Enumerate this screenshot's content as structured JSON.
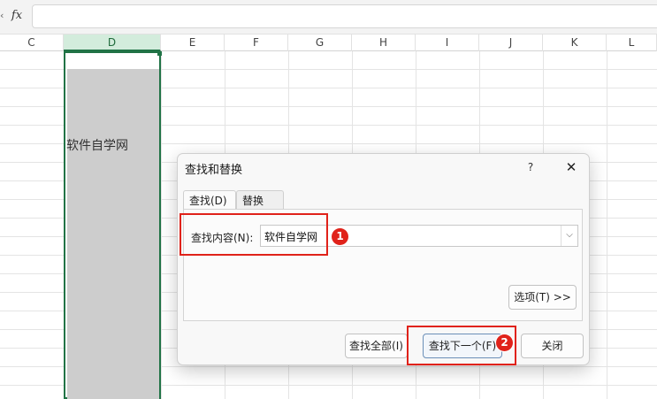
{
  "formula_bar": {
    "cancel_glyph": "‹",
    "fx_label": "fx"
  },
  "columns": [
    "C",
    "D",
    "E",
    "F",
    "G",
    "H",
    "I",
    "J",
    "K",
    "L"
  ],
  "selected_column": "D",
  "cell": {
    "text": "软件自学网"
  },
  "dialog": {
    "title": "查找和替换",
    "help": "?",
    "close": "✕",
    "tabs": {
      "find": "查找(D)",
      "replace": "替换(P)"
    },
    "find_label": "查找内容(N):",
    "find_value": "软件自学网",
    "dropdown_glyph": "⌵",
    "buttons": {
      "options": "选项(T) >>",
      "find_all": "查找全部(I)",
      "find_next": "查找下一个(F)",
      "close": "关闭"
    }
  },
  "annotations": {
    "badge_1": "1",
    "badge_2": "2"
  },
  "colors": {
    "selection": "#217346",
    "annotation": "#e0221a",
    "selected_header_bg": "#d3ecdc"
  }
}
